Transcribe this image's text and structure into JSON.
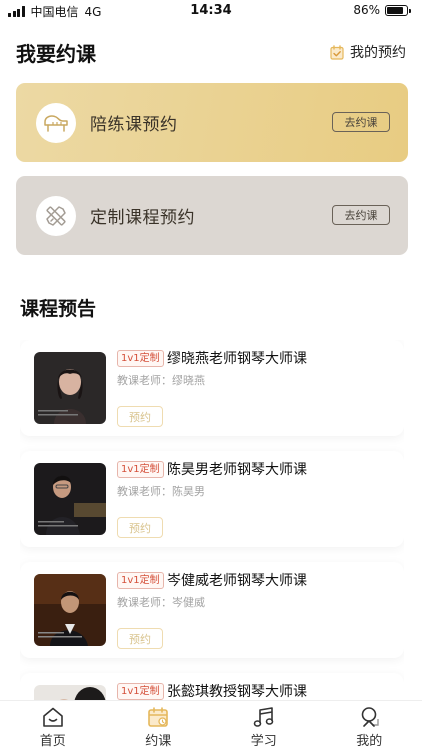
{
  "status_bar": {
    "carrier": "中国电信",
    "network": "4G",
    "time": "14:34",
    "battery_percent": "86%",
    "battery_level": 0.86
  },
  "header": {
    "title": "我要约课",
    "my_booking_label": "我的预约"
  },
  "booking_cards": {
    "practice": {
      "title": "陪练课预约",
      "button": "去约课",
      "icon": "piano-icon"
    },
    "custom": {
      "title": "定制课程预约",
      "button": "去约课",
      "icon": "pencil-ruler-icon"
    }
  },
  "section": {
    "title": "课程预告"
  },
  "courses": [
    {
      "tag": "1v1定制",
      "title": "缪晓燕老师钢琴大师课",
      "teacher": "教课老师：缪晓燕",
      "button": "预约"
    },
    {
      "tag": "1v1定制",
      "title": "陈昊男老师钢琴大师课",
      "teacher": "教课老师：陈昊男",
      "button": "预约"
    },
    {
      "tag": "1v1定制",
      "title": "岑健威老师钢琴大师课",
      "teacher": "教课老师：岑健威",
      "button": "预约"
    },
    {
      "tag": "1v1定制",
      "title": "张懿琪教授钢琴大师课",
      "teacher": "",
      "button": ""
    }
  ],
  "tabbar": {
    "items": [
      {
        "label": "首页",
        "icon": "home-icon"
      },
      {
        "label": "约课",
        "icon": "calendar-icon",
        "active": true
      },
      {
        "label": "学习",
        "icon": "music-note-icon"
      },
      {
        "label": "我的",
        "icon": "profile-icon"
      }
    ]
  },
  "colors": {
    "gold": "#e8cc82",
    "grey_card": "#dcd7d2",
    "tag_red": "#d4503a",
    "active_tab": "#e5b85c"
  }
}
